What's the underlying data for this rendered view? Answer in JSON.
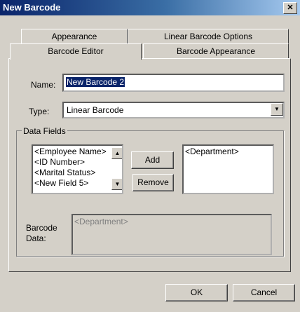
{
  "window": {
    "title": "New Barcode",
    "close_icon": "close-icon"
  },
  "tabs": {
    "back_row": [
      "Appearance",
      "Linear Barcode Options"
    ],
    "front_row": [
      "Barcode Editor",
      "Barcode Appearance"
    ]
  },
  "form": {
    "name_label": "Name:",
    "name_value": "New Barcode 2",
    "type_label": "Type:",
    "type_value": "Linear Barcode"
  },
  "data_fields": {
    "group_label": "Data Fields",
    "available": [
      "<Employee Name>",
      "<ID Number>",
      "<Marital Status>",
      "<New Field 5>"
    ],
    "selected": [
      "<Department>"
    ],
    "add_label": "Add",
    "remove_label": "Remove",
    "barcode_data_label": "Barcode Data:",
    "barcode_data_value": "<Department>"
  },
  "footer": {
    "ok_label": "OK",
    "cancel_label": "Cancel"
  }
}
